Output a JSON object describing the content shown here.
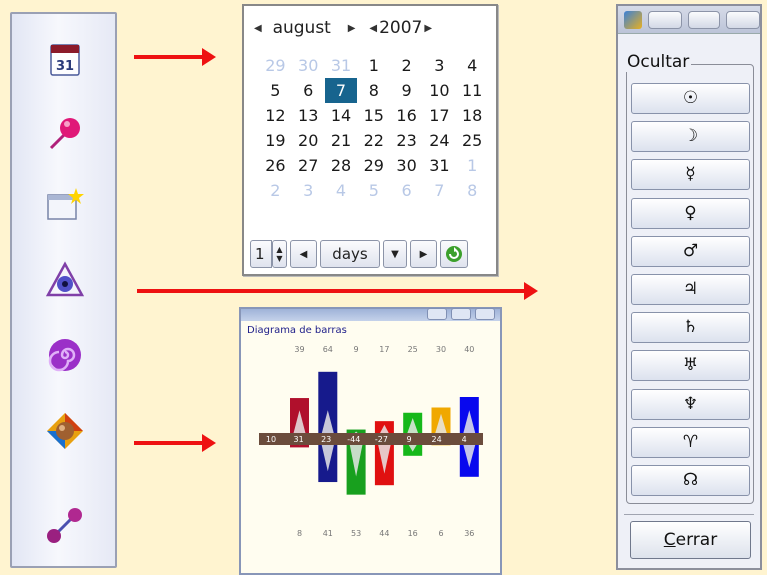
{
  "toolbar": {
    "icons": [
      {
        "name": "calendar-icon",
        "label": "31"
      },
      {
        "name": "pin-icon"
      },
      {
        "name": "new-window-icon"
      },
      {
        "name": "triangle-eye-icon"
      },
      {
        "name": "spiral-icon"
      },
      {
        "name": "diamond-planet-icon"
      },
      {
        "name": "link-pin-icon"
      }
    ]
  },
  "calendar": {
    "month": "august",
    "year": "2007",
    "weeks": [
      [
        {
          "d": "29",
          "dim": true
        },
        {
          "d": "30",
          "dim": true
        },
        {
          "d": "31",
          "dim": true
        },
        {
          "d": "1"
        },
        {
          "d": "2"
        },
        {
          "d": "3"
        },
        {
          "d": "4"
        }
      ],
      [
        {
          "d": "5"
        },
        {
          "d": "6"
        },
        {
          "d": "7",
          "sel": true
        },
        {
          "d": "8"
        },
        {
          "d": "9"
        },
        {
          "d": "10"
        },
        {
          "d": "11"
        }
      ],
      [
        {
          "d": "12"
        },
        {
          "d": "13"
        },
        {
          "d": "14"
        },
        {
          "d": "15"
        },
        {
          "d": "16"
        },
        {
          "d": "17"
        },
        {
          "d": "18"
        }
      ],
      [
        {
          "d": "19"
        },
        {
          "d": "20"
        },
        {
          "d": "21"
        },
        {
          "d": "22"
        },
        {
          "d": "23"
        },
        {
          "d": "24"
        },
        {
          "d": "25"
        }
      ],
      [
        {
          "d": "26"
        },
        {
          "d": "27"
        },
        {
          "d": "28"
        },
        {
          "d": "29"
        },
        {
          "d": "30"
        },
        {
          "d": "31"
        },
        {
          "d": "1",
          "dim": true
        }
      ],
      [
        {
          "d": "2",
          "dim": true
        },
        {
          "d": "3",
          "dim": true
        },
        {
          "d": "4",
          "dim": true
        },
        {
          "d": "5",
          "dim": true
        },
        {
          "d": "6",
          "dim": true
        },
        {
          "d": "7",
          "dim": true
        },
        {
          "d": "8",
          "dim": true
        }
      ]
    ],
    "step_value": "1",
    "unit": "days"
  },
  "chart_window": {
    "title": "Diagrama de barras"
  },
  "chart_data": {
    "type": "bar",
    "title": "Diagrama de barras",
    "top_values": [
      39,
      64,
      9,
      17,
      25,
      30,
      40
    ],
    "center_values": [
      "10",
      "31",
      "23",
      "-44",
      "-27",
      "9",
      "24",
      "4"
    ],
    "bottom_values": [
      8,
      41,
      53,
      44,
      16,
      6,
      36
    ],
    "colors": [
      "#b0102c",
      "#161a8c",
      "#18a01e",
      "#e01010",
      "#16b81a",
      "#f0a800",
      "#0808ee"
    ]
  },
  "panel": {
    "legend": "Ocultar",
    "symbols": [
      "☉",
      "☽",
      "☿",
      "♀",
      "♂",
      "♃",
      "♄",
      "♅",
      "♆",
      "♈",
      "☊"
    ],
    "close_label": "Cerrar"
  }
}
